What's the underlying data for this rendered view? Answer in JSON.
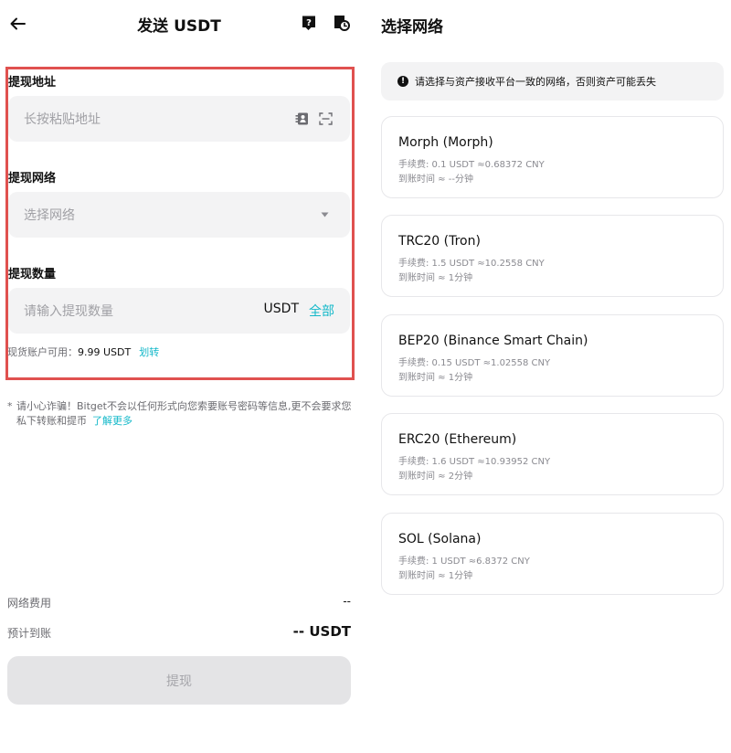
{
  "icons": {
    "back": "arrow-left-icon",
    "help": "help-icon",
    "history": "history-icon",
    "contacts": "address-book-icon",
    "scan": "scan-icon",
    "dropdown": "caret-down-icon",
    "notice": "exclamation-icon"
  },
  "colors": {
    "accent": "#13b8c9",
    "highlight_border": "#e0514f",
    "field_bg": "#f3f3f4",
    "disabled_button_bg": "#e4e4e6"
  },
  "header": {
    "title": "发送 USDT"
  },
  "form": {
    "address": {
      "label": "提现地址",
      "placeholder": "长按粘贴地址"
    },
    "network": {
      "label": "提现网络",
      "placeholder": "选择网络"
    },
    "amount": {
      "label": "提现数量",
      "placeholder": "请输入提现数量",
      "unit": "USDT",
      "all_label": "全部"
    },
    "balance": {
      "label": "现货账户可用：",
      "value": "9.99 USDT",
      "transfer_label": "划转"
    }
  },
  "warning": {
    "star": "*",
    "text": "请小心诈骗！Bitget不会以任何形式向您索要账号密码等信息,更不会要求您私下转账和提币",
    "link": "了解更多"
  },
  "summary": {
    "network_fee_label": "网络费用",
    "network_fee_value": "--",
    "expected_label": "预计到账",
    "expected_value": "-- USDT"
  },
  "submit": {
    "label": "提现"
  },
  "network_panel": {
    "title": "选择网络",
    "notice": "请选择与资产接收平台一致的网络，否则资产可能丢失",
    "networks": [
      {
        "name": "Morph (Morph)",
        "fee": "手续费: 0.1 USDT ≈0.68372 CNY",
        "time": "到账时间 ≈ --分钟"
      },
      {
        "name": "TRC20 (Tron)",
        "fee": "手续费: 1.5 USDT ≈10.2558 CNY",
        "time": "到账时间 ≈ 1分钟"
      },
      {
        "name": "BEP20 (Binance Smart Chain)",
        "fee": "手续费: 0.15 USDT ≈1.02558 CNY",
        "time": "到账时间 ≈ 1分钟"
      },
      {
        "name": "ERC20 (Ethereum)",
        "fee": "手续费: 1.6 USDT ≈10.93952 CNY",
        "time": "到账时间 ≈ 2分钟"
      },
      {
        "name": "SOL (Solana)",
        "fee": "手续费: 1 USDT ≈6.8372 CNY",
        "time": "到账时间 ≈ 1分钟"
      }
    ]
  }
}
